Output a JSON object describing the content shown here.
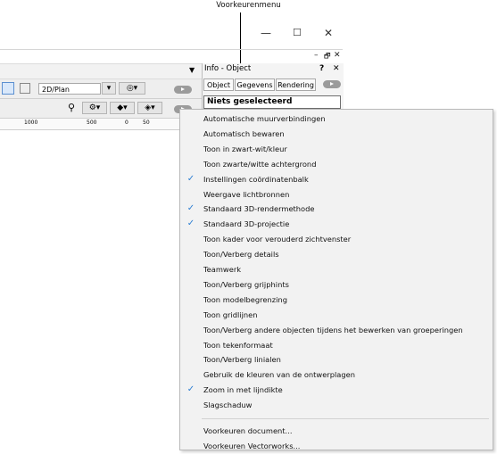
{
  "callout": {
    "label": "Voorkeurenmenu"
  },
  "window": {
    "minimize": "—",
    "maximize": "☐",
    "close": "✕"
  },
  "palette": {
    "minimize": "–",
    "restore": "🗗",
    "close": "✕"
  },
  "view": {
    "plan_value": "2D/Plan"
  },
  "ruler": {
    "t1": "1000",
    "t2": "500",
    "t3": "0",
    "t4": "50"
  },
  "info_palette": {
    "title": "Info - Object",
    "help": "?",
    "close": "✕",
    "tabs": [
      "Object",
      "Gegevens",
      "Rendering"
    ],
    "selection": "Niets geselecteerd"
  },
  "menu": {
    "items": [
      {
        "label": "Automatische muurverbindingen",
        "checked": false
      },
      {
        "label": "Automatisch bewaren",
        "checked": false
      },
      {
        "label": "Toon in zwart-wit/kleur",
        "checked": false
      },
      {
        "label": "Toon zwarte/witte achtergrond",
        "checked": false
      },
      {
        "label": "Instellingen coördinatenbalk",
        "checked": true
      },
      {
        "label": "Weergave lichtbronnen",
        "checked": false
      },
      {
        "label": "Standaard 3D-rendermethode",
        "checked": true
      },
      {
        "label": "Standaard 3D-projectie",
        "checked": true
      },
      {
        "label": "Toon kader voor verouderd zichtvenster",
        "checked": false
      },
      {
        "label": "Toon/Verberg details",
        "checked": false
      },
      {
        "label": "Teamwerk",
        "checked": false
      },
      {
        "label": "Toon/Verberg grijphints",
        "checked": false
      },
      {
        "label": "Toon modelbegrenzing",
        "checked": false
      },
      {
        "label": "Toon gridlijnen",
        "checked": false
      },
      {
        "label": "Toon/Verberg andere objecten tijdens het bewerken van groeperingen",
        "checked": false
      },
      {
        "label": "Toon tekenformaat",
        "checked": false
      },
      {
        "label": "Toon/Verberg linialen",
        "checked": false
      },
      {
        "label": "Gebruik de kleuren van de ontwerplagen",
        "checked": false
      },
      {
        "label": "Zoom in met lijndikte",
        "checked": true
      },
      {
        "label": "Slagschaduw",
        "checked": false
      }
    ],
    "footer_items": [
      {
        "label": "Voorkeuren document..."
      },
      {
        "label": "Voorkeuren Vectorworks..."
      }
    ],
    "check_color": "#2e7fd3"
  }
}
